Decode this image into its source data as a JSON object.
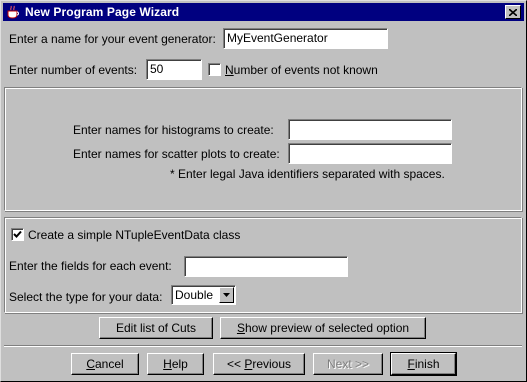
{
  "window": {
    "title": "New Program Page Wizard",
    "icons": {
      "app": "java-cup-icon",
      "close": "close-icon"
    }
  },
  "generator": {
    "name_label": "Enter a name for your event generator:",
    "name_value": "MyEventGenerator",
    "events_label": "Enter number of events:",
    "events_value": "50",
    "events_unknown_label": "Number of events not known",
    "events_unknown_checked": false
  },
  "plots": {
    "histograms_label": "Enter names for histograms to create:",
    "histograms_value": "",
    "scatter_label": "Enter names for scatter plots to create:",
    "scatter_value": "",
    "note": "* Enter legal Java identifiers separated with spaces."
  },
  "ntuple": {
    "create_label": "Create a simple NTupleEventData class",
    "create_checked": true,
    "fields_label": "Enter the fields for each event:",
    "fields_value": "",
    "type_label": "Select the type for your data:",
    "type_value": "Double"
  },
  "actions": {
    "edit_cuts": "Edit list of Cuts",
    "show_preview": "Show preview of selected option"
  },
  "footer": {
    "cancel": "Cancel",
    "help": "Help",
    "previous": "<< Previous",
    "next": "Next >>",
    "finish": "Finish"
  }
}
